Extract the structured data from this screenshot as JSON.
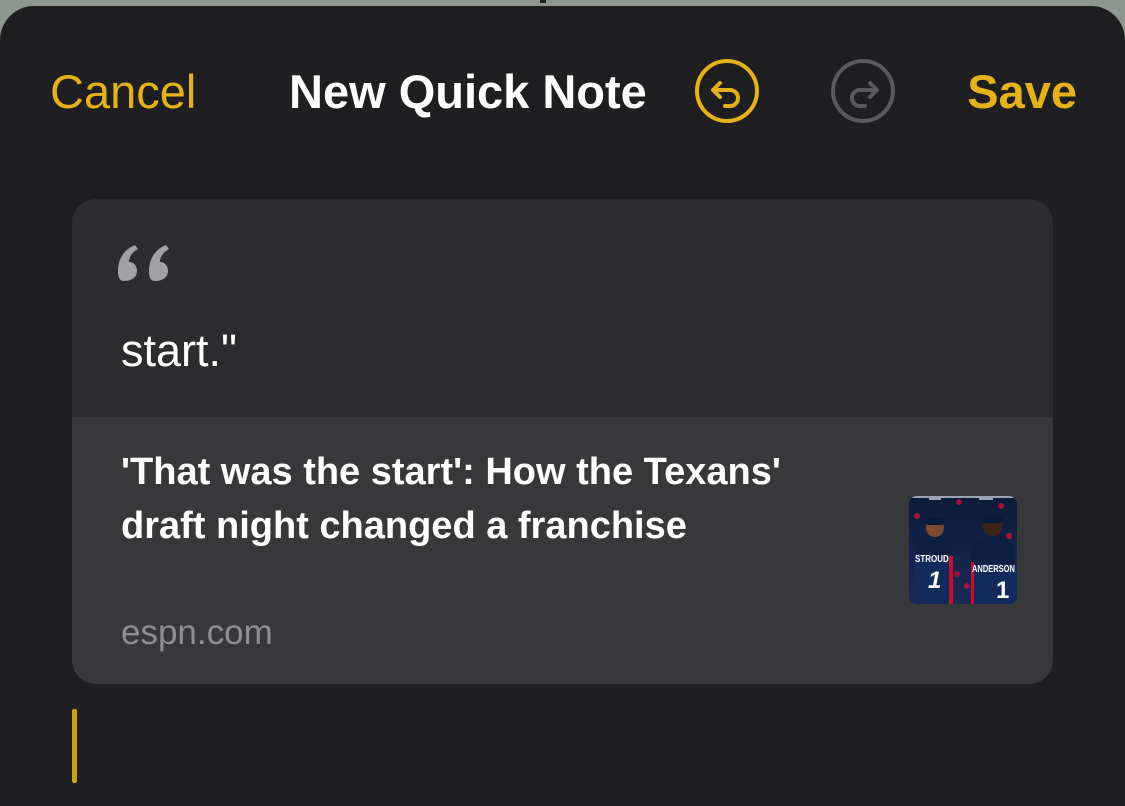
{
  "nav": {
    "cancel_label": "Cancel",
    "title": "New Quick Note",
    "save_label": "Save",
    "undo_icon": "undo-icon",
    "redo_icon": "redo-icon",
    "accent_color": "#e5b21c",
    "disabled_color": "#5a5a5e"
  },
  "note": {
    "quote_icon": "quote-icon",
    "quote_text": "start.\"",
    "link": {
      "title": "'That was the start': How the Texans' draft night changed a franchise",
      "domain": "espn.com",
      "thumbnail": {
        "left_name": "STROUD",
        "left_number": "1",
        "right_name": "ANDERSON",
        "right_number": "1"
      }
    }
  }
}
